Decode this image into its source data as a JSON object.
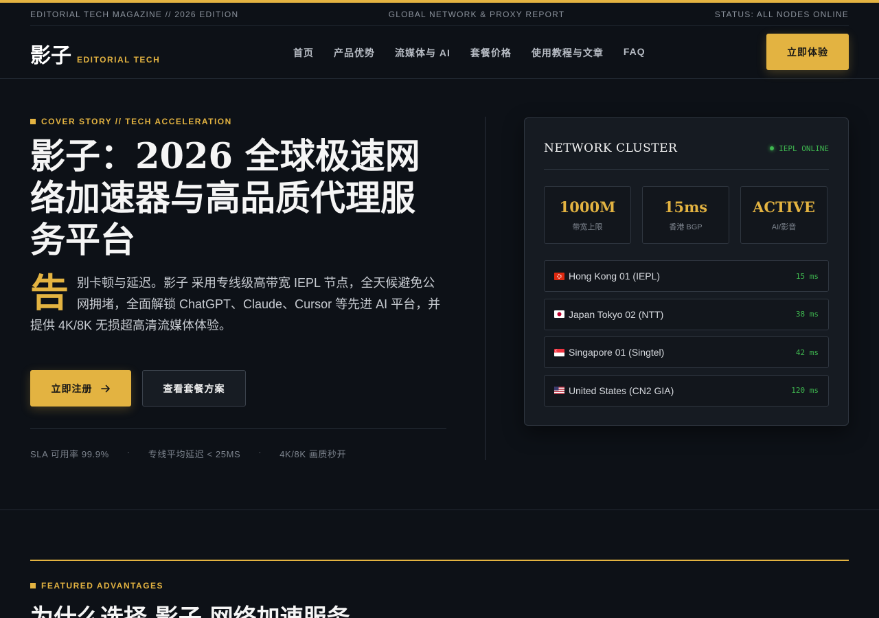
{
  "colors": {
    "accent": "#e3b341",
    "background": "#0d1117",
    "online": "#3fb950"
  },
  "topbar": {
    "left": "EDITORIAL TECH MAGAZINE // 2026 EDITION",
    "center": "GLOBAL NETWORK & PROXY REPORT",
    "right": "STATUS: ALL NODES ONLINE"
  },
  "header": {
    "logo": "影子",
    "logo_sub": "EDITORIAL TECH",
    "nav": [
      "首页",
      "产品优势",
      "流媒体与 AI",
      "套餐价格",
      "使用教程与文章",
      "FAQ"
    ],
    "cta": "立即体验"
  },
  "hero": {
    "kicker": "COVER STORY // TECH ACCELERATION",
    "title": "影子：2026 全球极速网络加速器与高品质代理服务平台",
    "dropcap": "告",
    "description": "别卡顿与延迟。影子 采用专线级高带宽 IEPL 节点，全天候避免公网拥堵，全面解锁 ChatGPT、Claude、Cursor 等先进 AI 平台，并提供 4K/8K 无损超高清流媒体体验。",
    "primary_button": "立即注册",
    "primary_icon": "arrow-right-icon",
    "secondary_button": "查看套餐方案",
    "stats": [
      "SLA 可用率 99.9%",
      "专线平均延迟 < 25MS",
      "4K/8K 画质秒开"
    ],
    "stats_separator": "·"
  },
  "panel": {
    "title": "NETWORK CLUSTER",
    "status": "IEPL ONLINE",
    "metrics": [
      {
        "value": "1000M",
        "label": "带宽上限"
      },
      {
        "value": "15ms",
        "label": "香港 BGP"
      },
      {
        "value": "ACTIVE",
        "label": "AI/影音"
      }
    ],
    "nodes": [
      {
        "name": "Hong Kong 01 (IEPL)",
        "latency": "15 ms",
        "flag": "hk-flag-icon"
      },
      {
        "name": "Japan Tokyo 02 (NTT)",
        "latency": "38 ms",
        "flag": "jp-flag-icon"
      },
      {
        "name": "Singapore 01 (Singtel)",
        "latency": "42 ms",
        "flag": "sg-flag-icon"
      },
      {
        "name": "United States (CN2 GIA)",
        "latency": "120 ms",
        "flag": "us-flag-icon"
      }
    ]
  },
  "section": {
    "kicker": "FEATURED ADVANTAGES",
    "title": "为什么选择 影子 网络加速服务"
  }
}
